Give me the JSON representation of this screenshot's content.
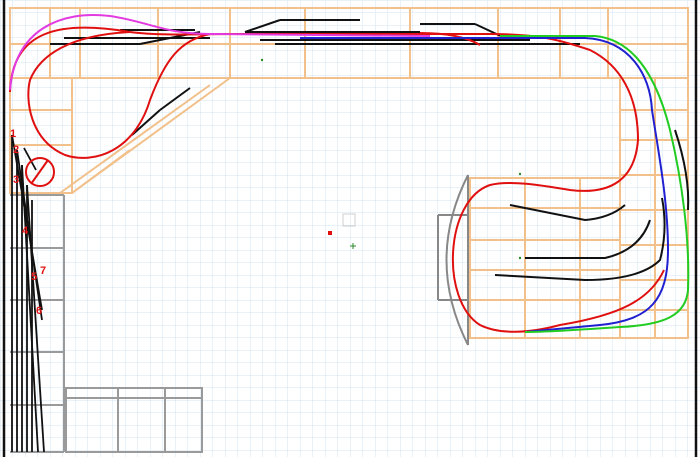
{
  "app": {
    "view": "track-plan-editor-canvas"
  },
  "turnout_labels": [
    "1",
    "2",
    "3",
    "4",
    "5",
    "6",
    "7"
  ],
  "colors": {
    "background": "#ffffff",
    "grid_line": "#d2e4f0",
    "benchwork": "#f2c08a",
    "walls": "#111111",
    "track_black": "#111111",
    "track_red": "#e01010",
    "track_magenta": "#e23be0",
    "track_blue": "#2020d0",
    "track_green": "#22cc22",
    "turntable_outline": "#888888",
    "label_text": "#e01010"
  }
}
